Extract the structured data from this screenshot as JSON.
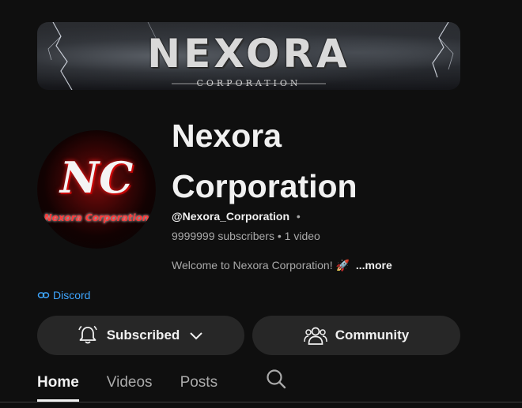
{
  "banner": {
    "title": "NEXORA",
    "subtitle": "CORPORATION"
  },
  "avatar": {
    "monogram": "NC",
    "name": "Nexora Corporation"
  },
  "channel": {
    "name": "Nexora Corporation",
    "handle": "@Nexora_Corporation",
    "handle_separator": "•",
    "stats": "9999999 subscribers • 1 video",
    "description": "Welcome to Nexora Corporation! ",
    "description_emoji": "🚀",
    "more_label": "...more",
    "link_label": "Discord",
    "link_color": "#3ea6ff"
  },
  "buttons": {
    "subscribed_label": "Subscribed",
    "subscribed_icon": "bell-icon",
    "community_label": "Community",
    "community_icon": "people-icon"
  },
  "tabs": [
    {
      "label": "Home",
      "active": true
    },
    {
      "label": "Videos",
      "active": false
    },
    {
      "label": "Posts",
      "active": false
    }
  ],
  "colors": {
    "background": "#0f0f0f",
    "button_bg": "#272727",
    "secondary_text": "#aaaaaa"
  }
}
